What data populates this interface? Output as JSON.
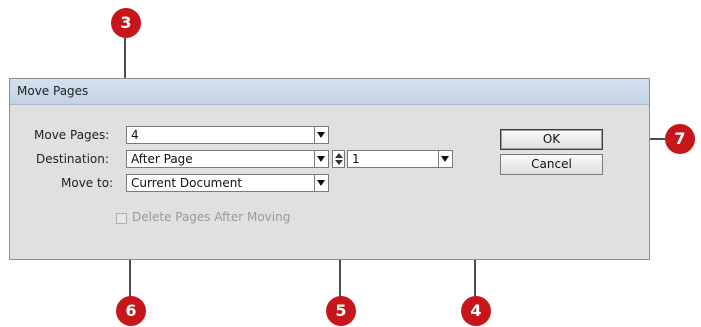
{
  "dialog": {
    "title": "Move Pages",
    "move_pages_label": "Move Pages:",
    "move_pages_value": "4",
    "destination_label": "Destination:",
    "destination_value": "After Page",
    "destination_page": "1",
    "move_to_label": "Move to:",
    "move_to_value": "Current Document",
    "delete_after_moving_label": "Delete Pages After Moving",
    "delete_after_moving_checked": false,
    "ok_label": "OK",
    "cancel_label": "Cancel"
  },
  "callouts": [
    "3",
    "7",
    "6",
    "5",
    "4"
  ],
  "colors": {
    "callout": "#c7161b",
    "titlebar": "#c9d8ea",
    "dialog_bg": "#e0e0e0"
  }
}
